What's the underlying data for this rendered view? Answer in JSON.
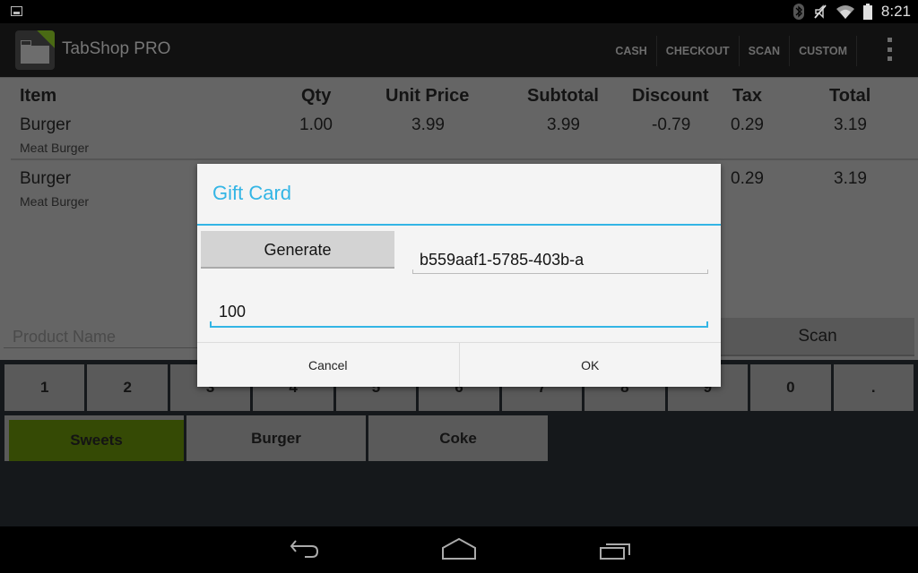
{
  "status_bar": {
    "time": "8:21",
    "icons": [
      "notification-image-icon",
      "bluetooth-icon",
      "mute-icon",
      "wifi-icon",
      "battery-icon"
    ]
  },
  "action_bar": {
    "app_title": "TabShop PRO",
    "icon": "cash-register-pro-icon",
    "actions": [
      "CASH",
      "CHECKOUT",
      "SCAN",
      "CUSTOM"
    ],
    "overflow_icon": "overflow-menu-icon"
  },
  "order_table": {
    "headers": {
      "item": "Item",
      "qty": "Qty",
      "unit_price": "Unit Price",
      "subtotal": "Subtotal",
      "discount": "Discount",
      "tax": "Tax",
      "total": "Total"
    },
    "rows": [
      {
        "item": "Burger",
        "description": "Meat Burger",
        "qty": "1.00",
        "unit_price": "3.99",
        "subtotal": "3.99",
        "discount": "-0.79",
        "tax": "0.29",
        "total": "3.19"
      },
      {
        "item": "Burger",
        "description": "Meat Burger",
        "qty": "",
        "unit_price": "",
        "subtotal": "",
        "discount": "",
        "tax": "0.29",
        "total": "3.19"
      }
    ]
  },
  "product_input": {
    "placeholder": "Product Name"
  },
  "scan_button": "Scan",
  "keypad": [
    "1",
    "2",
    "3",
    "4",
    "5",
    "6",
    "7",
    "8",
    "9",
    "0",
    "."
  ],
  "categories": [
    {
      "label": "Sweets",
      "active": true
    },
    {
      "label": "Burger",
      "active": false
    },
    {
      "label": "Coke",
      "active": false
    }
  ],
  "dialog": {
    "title": "Gift Card",
    "generate_label": "Generate",
    "code_value": "b559aaf1-5785-403b-a",
    "amount_value": "100",
    "cancel_label": "Cancel",
    "ok_label": "OK"
  },
  "colors": {
    "accent": "#33b5e5",
    "active_category": "#354a05",
    "ribbon": "#4a6a14"
  },
  "nav_bar": {
    "icons": [
      "back-icon",
      "home-icon",
      "recents-icon"
    ]
  }
}
